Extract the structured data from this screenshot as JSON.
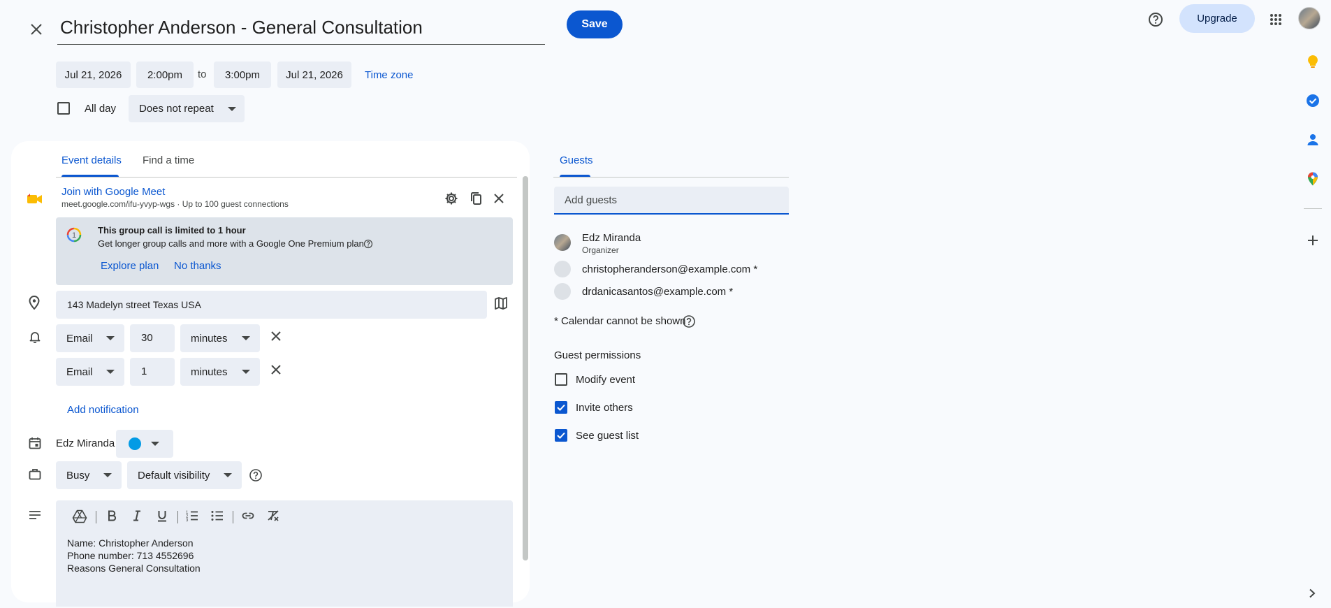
{
  "header": {
    "title": "Christopher Anderson - General Consultation",
    "save_label": "Save",
    "upgrade_label": "Upgrade"
  },
  "datetime": {
    "start_date": "Jul 21, 2026",
    "start_time": "2:00pm",
    "to_label": "to",
    "end_time": "3:00pm",
    "end_date": "Jul 21, 2026",
    "timezone_label": "Time zone",
    "all_day_label": "All day",
    "all_day_checked": false,
    "repeat": "Does not repeat"
  },
  "tabs": [
    {
      "label": "Event details",
      "active": true
    },
    {
      "label": "Find a time",
      "active": false
    }
  ],
  "meet": {
    "join_label": "Join with Google Meet",
    "subtitle": "meet.google.com/ifu-yvyp-wgs · Up to 100 guest connections",
    "promo_title": "This group call is limited to 1 hour",
    "promo_text": "Get longer group calls and more with a Google One Premium plan",
    "promo_badge": "1",
    "explore_label": "Explore plan",
    "no_thanks_label": "No thanks"
  },
  "location": "143 Madelyn street  Texas USA",
  "notifications": [
    {
      "method": "Email",
      "value": "30",
      "unit": "minutes"
    },
    {
      "method": "Email",
      "value": "1",
      "unit": "minutes"
    }
  ],
  "add_notification_label": "Add notification",
  "calendar": {
    "owner": "Edz Miranda",
    "color": "#039be5"
  },
  "availability": "Busy",
  "visibility": "Default visibility",
  "description": {
    "lines": [
      "Name: Christopher Anderson",
      "Phone number:  713 4552696",
      "Reasons General Consultation"
    ]
  },
  "guests": {
    "tab_label": "Guests",
    "add_placeholder": "Add guests",
    "list": [
      {
        "name": "Edz Miranda",
        "role": "Organizer"
      },
      {
        "email": "christopheranderson@example.com *"
      },
      {
        "email": "drdanicasantos@example.com *"
      }
    ],
    "calendar_note": "* Calendar cannot be shown",
    "permissions_title": "Guest permissions",
    "permissions": [
      {
        "label": "Modify event",
        "checked": false
      },
      {
        "label": "Invite others",
        "checked": true
      },
      {
        "label": "See guest list",
        "checked": true
      }
    ]
  },
  "colors": {
    "accent": "#0b57d0",
    "field_bg": "#eaeef5",
    "page_bg": "#f8fafd"
  }
}
